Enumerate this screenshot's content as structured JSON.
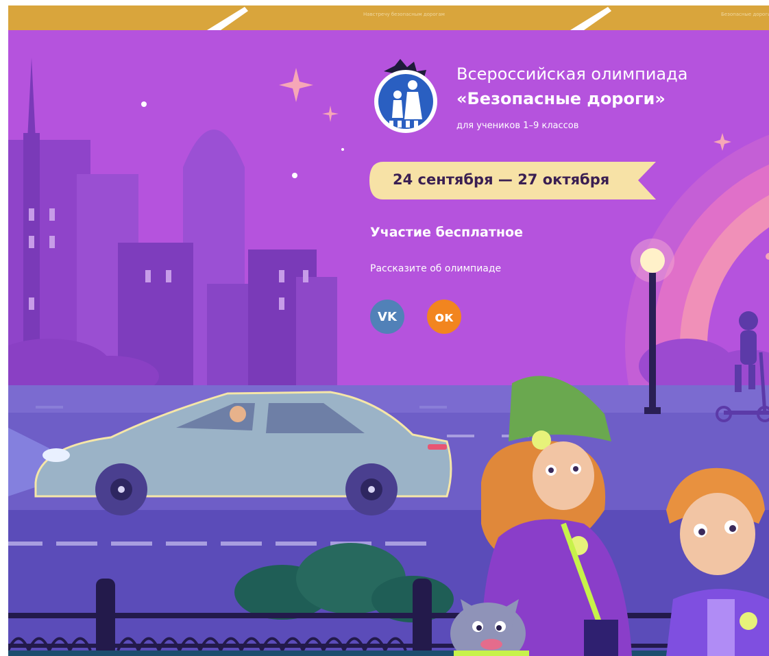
{
  "banner": {
    "title_line1": "Всероссийская олимпиада",
    "title_line2": "«Безопасные дороги»",
    "title_line3": "для учеников 1–9 классов",
    "dates": "24 сентября — 27 октября",
    "free_participation": "Участие бесплатное",
    "share_prompt": "Рассказите об олимпиаде"
  },
  "top_strip": {
    "caption_1": "Навстречу безопасным дорогам",
    "caption_2": "Безопасные дороги"
  },
  "social": {
    "vk_label": "VK",
    "ok_label": "ок"
  },
  "colors": {
    "background": "#b553dd",
    "strip": "#d9a53c",
    "date_pill": "#f7e2a6",
    "vk": "#5181b8",
    "ok": "#f2851f"
  },
  "icons": [
    "olympiad-logo-icon",
    "vk-icon",
    "ok-icon",
    "sparkle-icon"
  ]
}
